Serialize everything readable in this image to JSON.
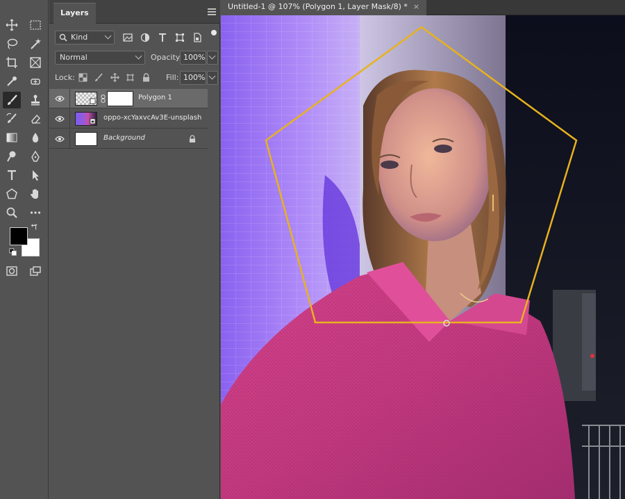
{
  "tools": [
    {
      "name": "move-tool-icon"
    },
    {
      "name": "marquee-tool-icon"
    },
    {
      "name": "lasso-tool-icon"
    },
    {
      "name": "magic-wand-icon"
    },
    {
      "name": "crop-tool-icon"
    },
    {
      "name": "frame-tool-icon"
    },
    {
      "name": "eyedropper-icon"
    },
    {
      "name": "healing-brush-icon"
    },
    {
      "name": "brush-tool-icon"
    },
    {
      "name": "clone-stamp-icon"
    },
    {
      "name": "history-brush-icon"
    },
    {
      "name": "eraser-icon"
    },
    {
      "name": "gradient-icon"
    },
    {
      "name": "blur-drop-icon"
    },
    {
      "name": "dodge-icon"
    },
    {
      "name": "pen-tool-icon"
    },
    {
      "name": "type-tool-icon"
    },
    {
      "name": "path-select-icon"
    },
    {
      "name": "polygon-shape-icon"
    },
    {
      "name": "hand-tool-icon"
    },
    {
      "name": "zoom-tool-icon"
    },
    {
      "name": "more-tools-icon"
    }
  ],
  "swatches": {
    "foreground": "#000000",
    "background": "#ffffff"
  },
  "layers_panel": {
    "tab_title": "Layers",
    "filter_kind": "Kind",
    "blend_mode": "Normal",
    "opacity_label": "Opacity:",
    "opacity_value": "100%",
    "lock_label": "Lock:",
    "fill_label": "Fill:",
    "fill_value": "100%",
    "layers": [
      {
        "name": "Polygon 1",
        "selected": true
      },
      {
        "name": "oppo-xcYaxvcAv3E-unsplash",
        "selected": false
      },
      {
        "name": "Background",
        "selected": false,
        "locked": true
      }
    ]
  },
  "document": {
    "tab_title": "Untitled-1 @ 107% (Polygon 1, Layer Mask/8) *",
    "close_glyph": "×"
  },
  "colors": {
    "polygon_stroke": "#e8b21e",
    "panel_bg": "#535353",
    "selected_layer": "#6a6a6a"
  }
}
